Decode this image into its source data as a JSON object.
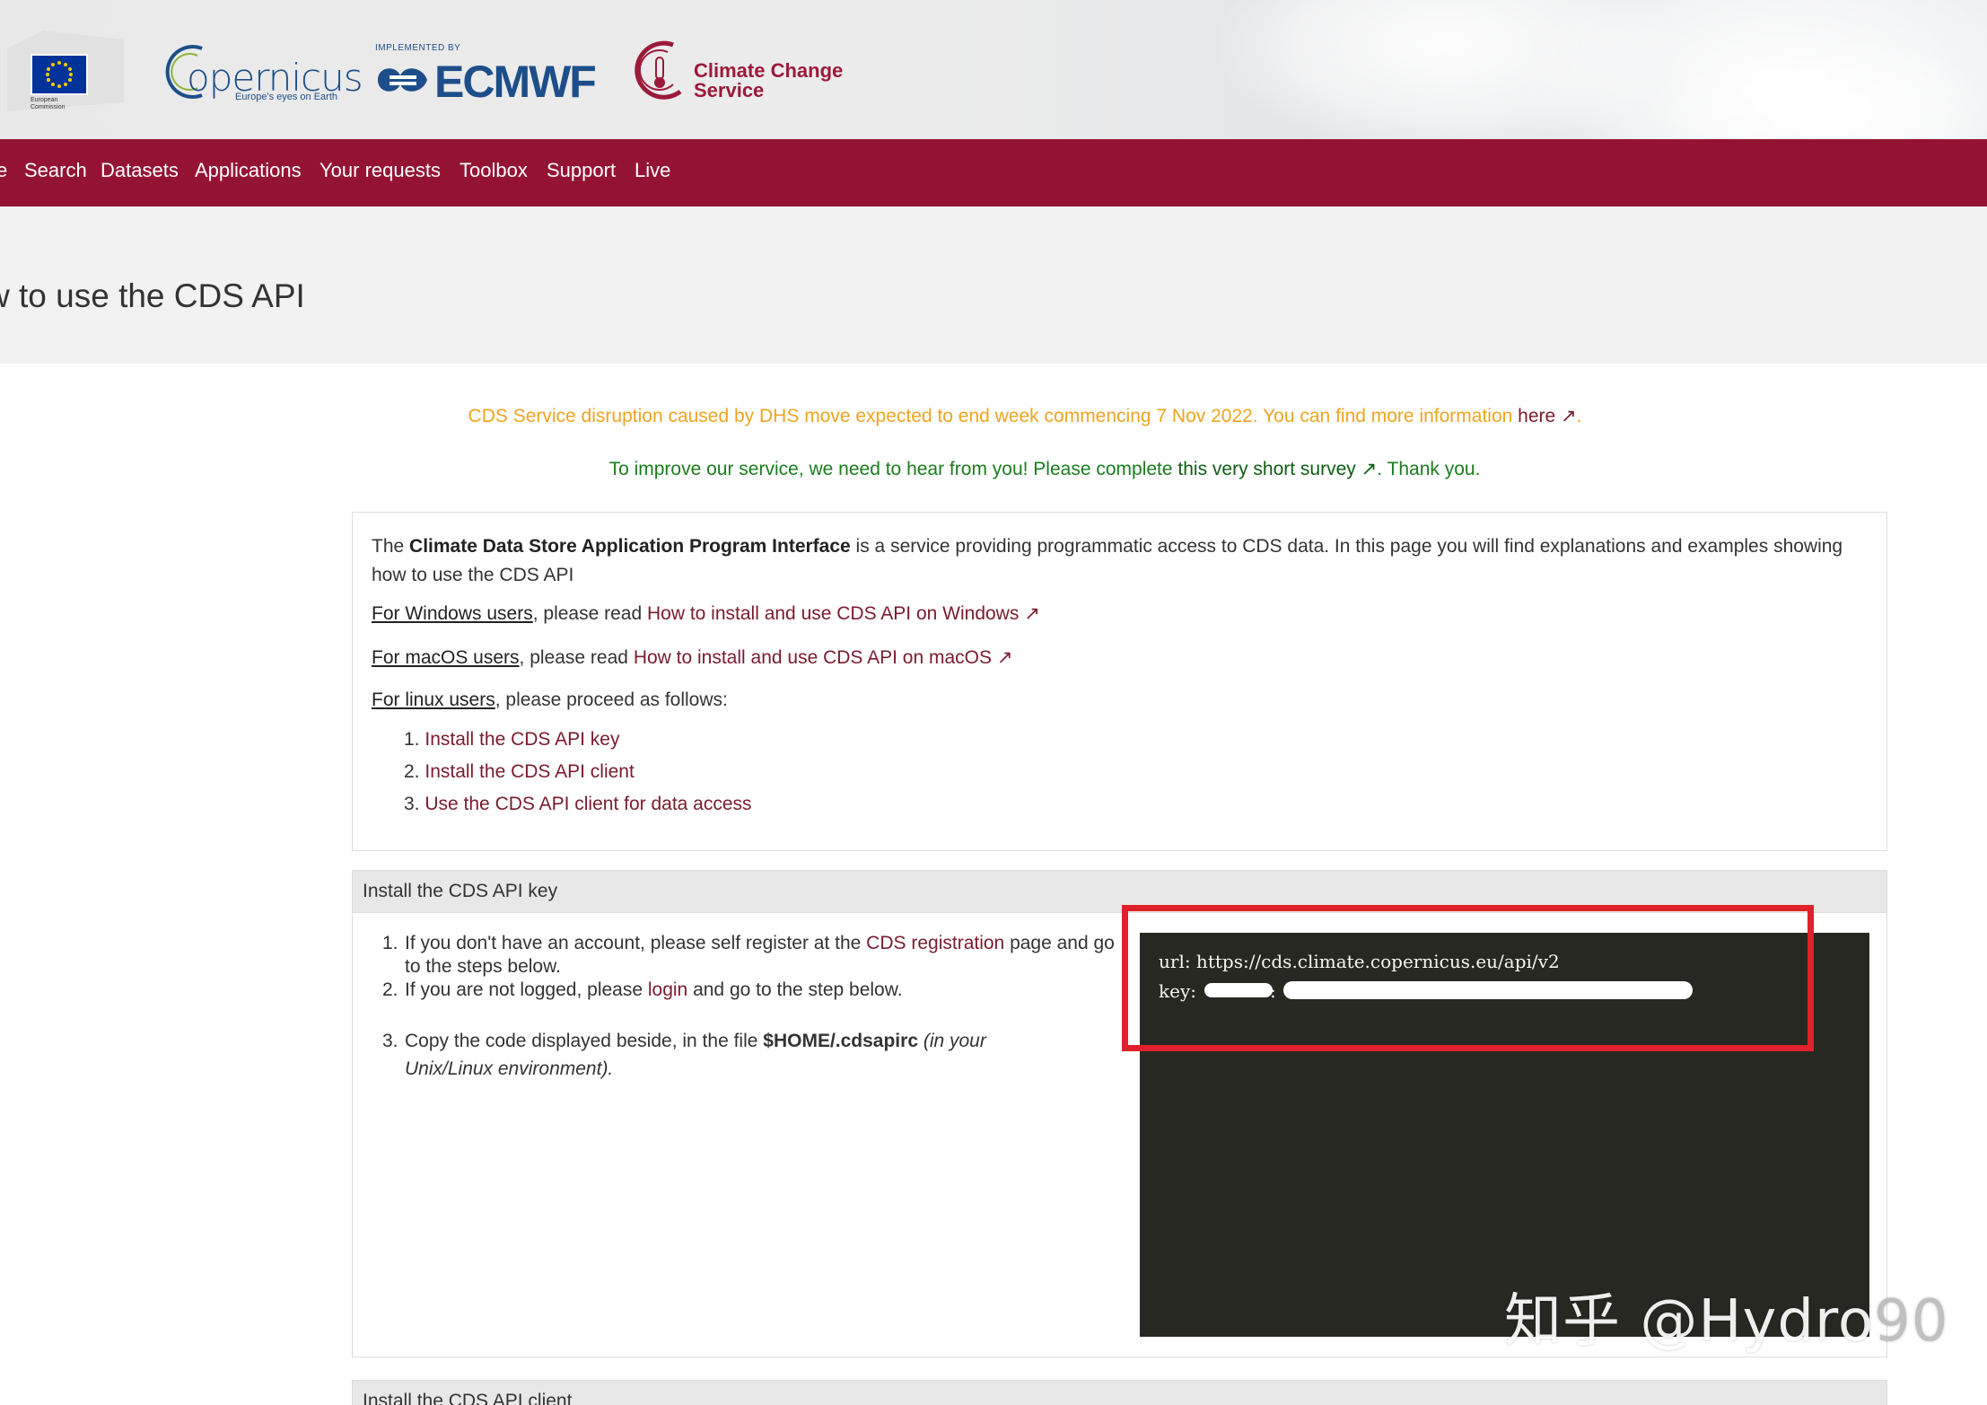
{
  "header": {
    "eu_label_line1": "European",
    "eu_label_line2": "Commission",
    "copernicus_name": "opernicus",
    "copernicus_tagline": "Europe's eyes on Earth",
    "ecmwf_implemented": "IMPLEMENTED BY",
    "ecmwf_name": "ECMWF",
    "ccs_line1": "Climate Change",
    "ccs_line2": "Service"
  },
  "nav": {
    "items": [
      "e",
      "Search",
      "Datasets",
      "Applications",
      "Your requests",
      "Toolbox",
      "Support",
      "Live"
    ]
  },
  "page": {
    "title": "w to use the CDS API"
  },
  "notices": {
    "disruption_text": "CDS Service disruption caused by DHS move expected to end week commencing 7 Nov 2022. You can find more information ",
    "disruption_link": "here",
    "survey_text": "To improve our service, we need to hear from you! Please complete ",
    "survey_link": "this very short survey",
    "survey_tail": ". Thank you."
  },
  "intro": {
    "p1_prefix": "The ",
    "p1_bold": "Climate Data Store Application Program Interface",
    "p1_suffix": " is a service providing programmatic access to CDS data. In this page you will find explanations and examples showing how to use the CDS API",
    "windows_label": "For Windows users",
    "windows_mid": ", please read ",
    "windows_link": "How to install and use CDS API on Windows",
    "macos_label": "For macOS users",
    "macos_mid": ", please read ",
    "macos_link": "How to install and use CDS API on macOS",
    "linux_label": "For linux users",
    "linux_tail": ", please proceed as follows:",
    "steps": [
      {
        "num": "1.",
        "label": "Install the CDS API key"
      },
      {
        "num": "2.",
        "label": "Install the CDS API client"
      },
      {
        "num": "3.",
        "label": "Use the CDS API client for data access"
      }
    ]
  },
  "key_panel": {
    "heading": "Install the CDS API key",
    "step1_a": "If you don't have an account, please self register at the ",
    "step1_link": "CDS registration",
    "step1_b": " page and go to the steps below.",
    "step2_a": "If you are not logged, please ",
    "step2_link": "login",
    "step2_b": " and go to the step below.",
    "step3_a": "Copy the code displayed beside, in the file ",
    "step3_bold": "$HOME/.cdsapirc",
    "step3_italic": " (in your Unix/Linux environment).",
    "code_url_line": "url: https://cds.climate.copernicus.eu/api/v2",
    "code_key_prefix": "key:",
    "code_key_sep": ":"
  },
  "client_panel": {
    "heading": "Install the CDS API client"
  },
  "watermark": {
    "text": "知乎 @Hydro",
    "tail": "90"
  },
  "colors": {
    "brand": "#941333",
    "link": "#7a1b2e",
    "notice_orange": "#f0a420",
    "notice_green": "#1b7d1e",
    "code_bg": "#272822",
    "highlight_frame": "#e0202a"
  }
}
